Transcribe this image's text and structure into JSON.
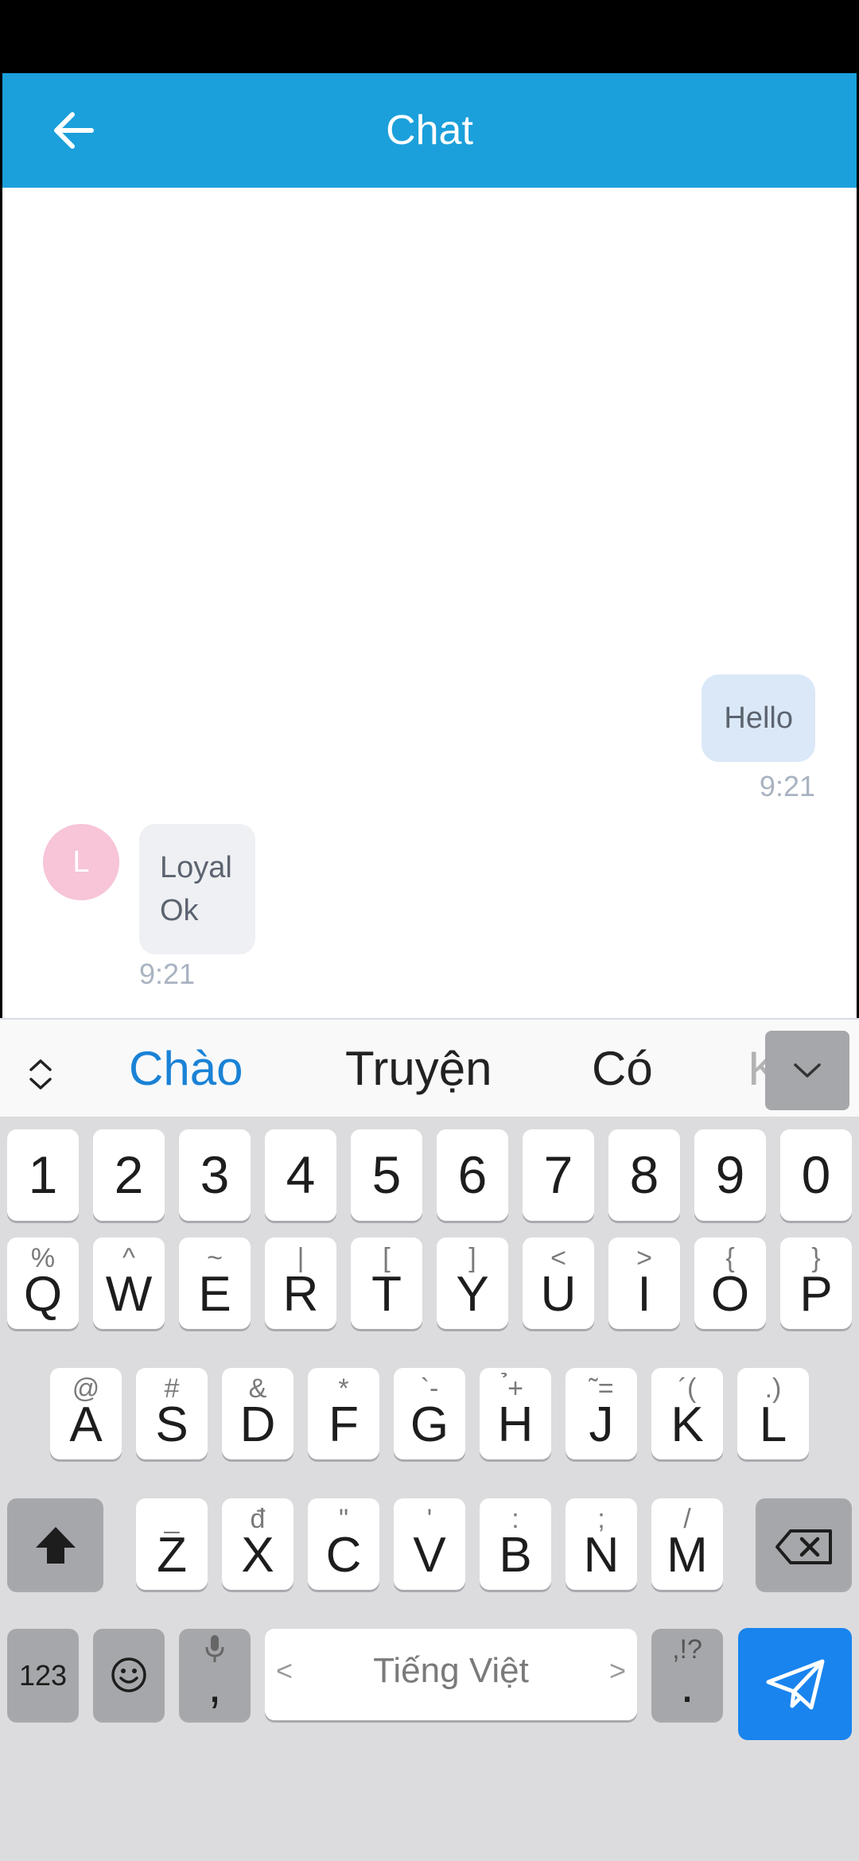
{
  "header": {
    "title": "Chat",
    "back_icon": "arrow-left-icon"
  },
  "messages": [
    {
      "direction": "outgoing",
      "text": "Hello",
      "time": "9:21"
    },
    {
      "direction": "incoming",
      "avatar_letter": "L",
      "sender": "Loyal",
      "text": "Ok",
      "time": "9:21"
    }
  ],
  "keyboard": {
    "suggestions": [
      "Chào",
      "Truyện",
      "Có",
      "K"
    ],
    "numbers": [
      "1",
      "2",
      "3",
      "4",
      "5",
      "6",
      "7",
      "8",
      "9",
      "0"
    ],
    "row1": [
      {
        "key": "Q",
        "sub": "%"
      },
      {
        "key": "W",
        "sub": "^"
      },
      {
        "key": "E",
        "sub": "~"
      },
      {
        "key": "R",
        "sub": "|"
      },
      {
        "key": "T",
        "sub": "["
      },
      {
        "key": "Y",
        "sub": "]"
      },
      {
        "key": "U",
        "sub": "<"
      },
      {
        "key": "I",
        "sub": ">"
      },
      {
        "key": "O",
        "sub": "{"
      },
      {
        "key": "P",
        "sub": "}"
      }
    ],
    "row2": [
      {
        "key": "A",
        "sub": "@"
      },
      {
        "key": "S",
        "sub": "#"
      },
      {
        "key": "D",
        "sub": "&"
      },
      {
        "key": "F",
        "sub": "*"
      },
      {
        "key": "G",
        "sub": "`-"
      },
      {
        "key": "H",
        "sub": "̉+"
      },
      {
        "key": "J",
        "sub": "˜="
      },
      {
        "key": "K",
        "sub": "´("
      },
      {
        "key": "L",
        "sub": ".)"
      }
    ],
    "row3": [
      {
        "key": "Z",
        "sub": "_"
      },
      {
        "key": "X",
        "sub": "đ"
      },
      {
        "key": "C",
        "sub": "\""
      },
      {
        "key": "V",
        "sub": "'"
      },
      {
        "key": "B",
        "sub": ":"
      },
      {
        "key": "N",
        "sub": ";"
      },
      {
        "key": "M",
        "sub": "/"
      }
    ],
    "symbols_key": "123",
    "mic_key_sub": ",",
    "space_label": "Tiếng Việt",
    "space_left_arrow": "<",
    "space_right_arrow": ">",
    "punct_key_top": ",!?",
    "punct_key_main": ".",
    "shift_icon": "shift-icon",
    "backspace_icon": "backspace-icon",
    "emoji_icon": "emoji-icon",
    "send_icon": "send-icon",
    "colors": {
      "header": "#1ba0db",
      "accent": "#1984ee",
      "suggest_primary": "#1a82d6"
    }
  }
}
